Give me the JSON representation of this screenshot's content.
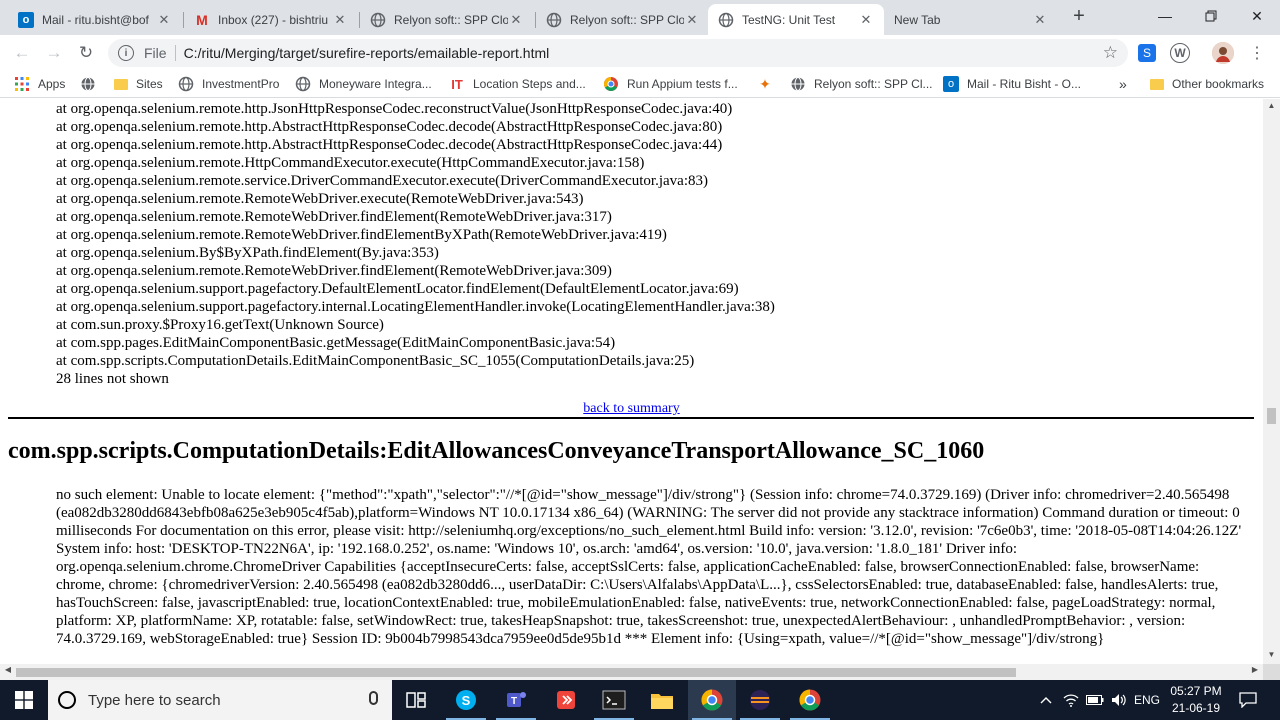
{
  "browser": {
    "tabs": [
      {
        "title": "Mail - ritu.bisht@bof",
        "icon": "outlook-icon"
      },
      {
        "title": "Inbox (227) - bishtriu",
        "icon": "gmail-icon"
      },
      {
        "title": "Relyon soft:: SPP Clo",
        "icon": "globe-icon"
      },
      {
        "title": "Relyon soft:: SPP Clo",
        "icon": "globe-icon"
      },
      {
        "title": "TestNG: Unit Test",
        "icon": "globe-icon",
        "active": true
      },
      {
        "title": "New Tab",
        "icon": ""
      }
    ],
    "new_tab": "+",
    "address": {
      "scheme": "File",
      "url": "C:/ritu/Merging/target/surefire-reports/emailable-report.html"
    },
    "bookmarks": [
      {
        "label": "Apps",
        "icon": "apps-grid-icon"
      },
      {
        "label": "",
        "icon": "globe-icon"
      },
      {
        "label": "Sites",
        "icon": "folder-icon"
      },
      {
        "label": "InvestmentPro",
        "icon": "globe-icon"
      },
      {
        "label": "Moneyware Integra...",
        "icon": "globe-icon"
      },
      {
        "label": "Location Steps and...",
        "icon": "it-icon"
      },
      {
        "label": "Run Appium tests f...",
        "icon": "chrome-icon"
      },
      {
        "label": "",
        "icon": "leaf-icon"
      },
      {
        "label": "Relyon soft:: SPP Cl...",
        "icon": "globe-icon"
      },
      {
        "label": "Mail - Ritu Bisht - O...",
        "icon": "outlook-icon"
      }
    ],
    "bookmarks_more": "»",
    "other_bookmarks": "Other bookmarks"
  },
  "report": {
    "trace_lines": [
      "at org.openqa.selenium.remote.http.JsonHttpResponseCodec.reconstructValue(JsonHttpResponseCodec.java:40)",
      "at org.openqa.selenium.remote.http.AbstractHttpResponseCodec.decode(AbstractHttpResponseCodec.java:80)",
      "at org.openqa.selenium.remote.http.AbstractHttpResponseCodec.decode(AbstractHttpResponseCodec.java:44)",
      "at org.openqa.selenium.remote.HttpCommandExecutor.execute(HttpCommandExecutor.java:158)",
      "at org.openqa.selenium.remote.service.DriverCommandExecutor.execute(DriverCommandExecutor.java:83)",
      "at org.openqa.selenium.remote.RemoteWebDriver.execute(RemoteWebDriver.java:543)",
      "at org.openqa.selenium.remote.RemoteWebDriver.findElement(RemoteWebDriver.java:317)",
      "at org.openqa.selenium.remote.RemoteWebDriver.findElementByXPath(RemoteWebDriver.java:419)",
      "at org.openqa.selenium.By$ByXPath.findElement(By.java:353)",
      "at org.openqa.selenium.remote.RemoteWebDriver.findElement(RemoteWebDriver.java:309)",
      "at org.openqa.selenium.support.pagefactory.DefaultElementLocator.findElement(DefaultElementLocator.java:69)",
      "at org.openqa.selenium.support.pagefactory.internal.LocatingElementHandler.invoke(LocatingElementHandler.java:38)",
      "at com.sun.proxy.$Proxy16.getText(Unknown Source)",
      "at com.spp.pages.EditMainComponentBasic.getMessage(EditMainComponentBasic.java:54)",
      "at com.spp.scripts.ComputationDetails.EditMainComponentBasic_SC_1055(ComputationDetails.java:25)",
      "28 lines not shown"
    ],
    "back_link": "back to summary",
    "method_heading": "com.spp.scripts.ComputationDetails:EditAllowancesConveyanceTransportAllowance_SC_1060",
    "error_message": "no such element: Unable to locate element: {\"method\":\"xpath\",\"selector\":\"//*[@id=\"show_message\"]/div/strong\"} (Session info: chrome=74.0.3729.169) (Driver info: chromedriver=2.40.565498 (ea082db3280dd6843ebfb08a625e3eb905c4f5ab),platform=Windows NT 10.0.17134 x86_64) (WARNING: The server did not provide any stacktrace information) Command duration or timeout: 0 milliseconds For documentation on this error, please visit: http://seleniumhq.org/exceptions/no_such_element.html Build info: version: '3.12.0', revision: '7c6e0b3', time: '2018-05-08T14:04:26.12Z' System info: host: 'DESKTOP-TN22N6A', ip: '192.168.0.252', os.name: 'Windows 10', os.arch: 'amd64', os.version: '10.0', java.version: '1.8.0_181' Driver info: org.openqa.selenium.chrome.ChromeDriver Capabilities {acceptInsecureCerts: false, acceptSslCerts: false, applicationCacheEnabled: false, browserConnectionEnabled: false, browserName: chrome, chrome: {chromedriverVersion: 2.40.565498 (ea082db3280dd6..., userDataDir: C:\\Users\\Alfalabs\\AppData\\L...}, cssSelectorsEnabled: true, databaseEnabled: false, handlesAlerts: true, hasTouchScreen: false, javascriptEnabled: true, locationContextEnabled: true, mobileEmulationEnabled: false, nativeEvents: true, networkConnectionEnabled: false, pageLoadStrategy: normal, platform: XP, platformName: XP, rotatable: false, setWindowRect: true, takesHeapSnapshot: true, takesScreenshot: true, unexpectedAlertBehaviour: , unhandledPromptBehavior: , version: 74.0.3729.169, webStorageEnabled: true} Session ID: 9b004b7998543dca7959ee0d5de95b1d *** Element info: {Using=xpath, value=//*[@id=\"show_message\"]/div/strong}"
  },
  "taskbar": {
    "search_placeholder": "Type here to search",
    "language": "ENG",
    "time": "05:27 PM",
    "date": "21-06-19"
  }
}
